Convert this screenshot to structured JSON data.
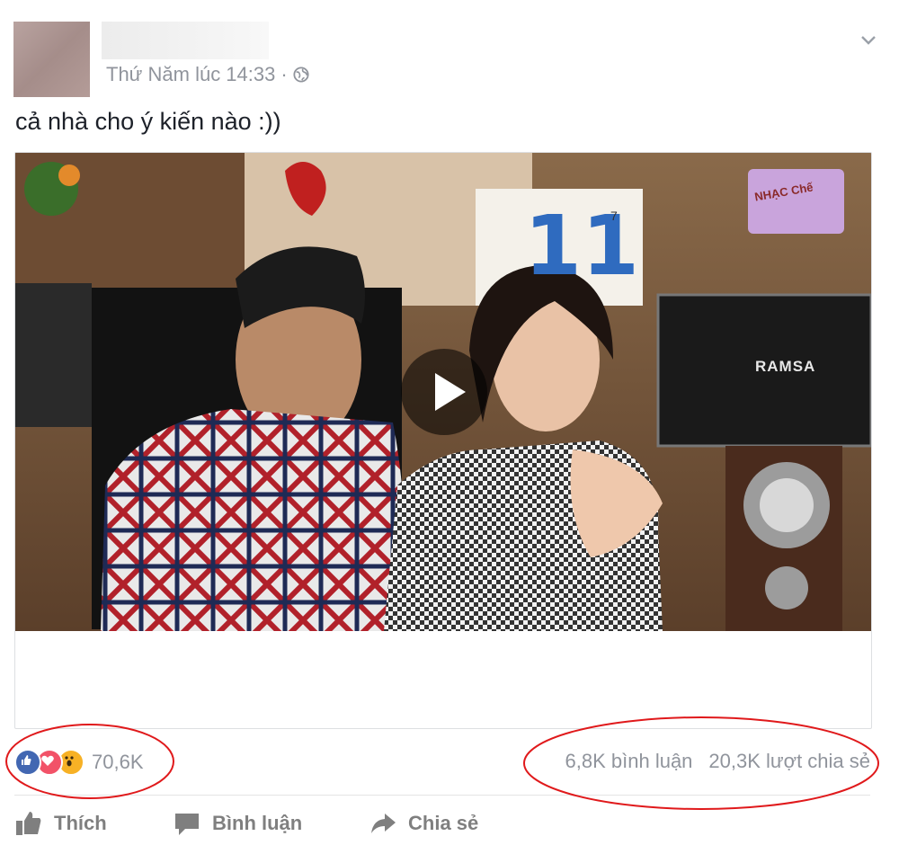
{
  "post": {
    "timestamp": "Thứ Năm lúc 14:33",
    "separator": "·",
    "privacy_icon": "globe-icon",
    "text": "cả nhà cho ý kiến nào :))"
  },
  "video": {
    "play_icon": "play-icon",
    "overlay_brand": "RAMSA",
    "calendar_day": "11",
    "calendar_small": "7",
    "logo_text": "NHẠC Chế"
  },
  "engagement": {
    "reaction_icons": [
      "like-reaction-icon",
      "love-reaction-icon",
      "wow-reaction-icon"
    ],
    "reaction_count": "70,6K",
    "comments": "6,8K bình luận",
    "shares": "20,3K lượt chia sẻ"
  },
  "actions": {
    "like_label": "Thích",
    "comment_label": "Bình luận",
    "share_label": "Chia sẻ"
  },
  "colors": {
    "meta_text": "#90949c",
    "body_text": "#1d2129",
    "like_blue": "#4267b2",
    "love_red": "#f25268",
    "wow_yellow": "#f7b125",
    "annotation_red": "#e0191b"
  }
}
